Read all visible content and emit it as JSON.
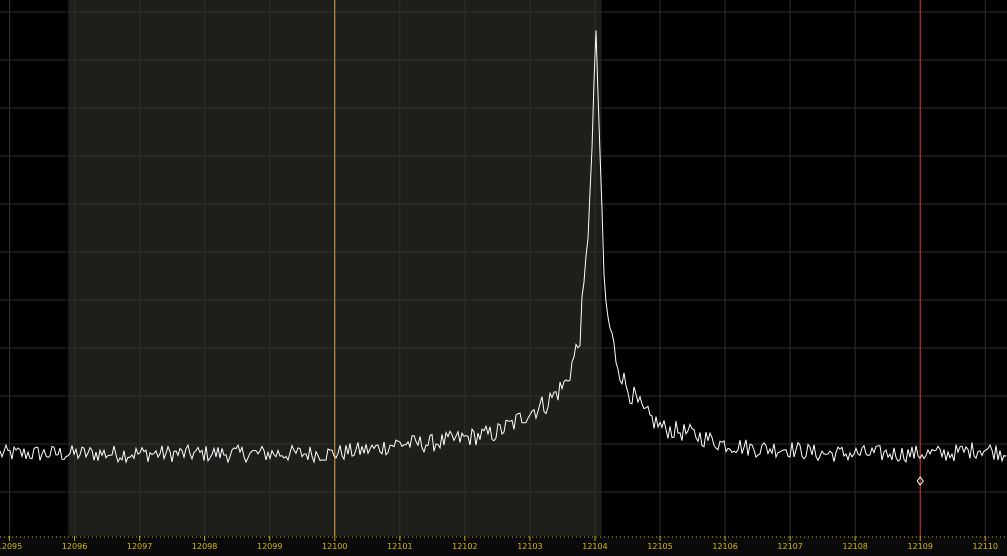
{
  "display": {
    "background": "#000000",
    "passband_fill": "#1e1f1a",
    "grid_color": "#2e302c",
    "trace_color": "#ffffff",
    "center_marker_color": "#e0a040",
    "cursor_marker_color": "#d83030",
    "axis_color": "#c8a800",
    "axis_bar_color": "#0a0a0a"
  },
  "chart_data": {
    "type": "line",
    "title": "",
    "xlabel": "",
    "ylabel": "",
    "xlim": [
      12094.9,
      12110.38
    ],
    "ylim": [
      0,
      1
    ],
    "grid": true,
    "x_ticks": [
      12095,
      12096,
      12097,
      12098,
      12099,
      12100,
      12101,
      12102,
      12103,
      12104,
      12105,
      12106,
      12107,
      12108,
      12109,
      12110
    ],
    "tick_labels": [
      "12095",
      "12096",
      "12097",
      "12098",
      "12099",
      "12100",
      "12101",
      "12102",
      "12103",
      "12104",
      "12105",
      "12106",
      "12107",
      "12108",
      "12109",
      "12110"
    ],
    "passband": [
      12095.95,
      12104.15
    ],
    "center_marker": 12100,
    "cursor_marker": 12109,
    "peak": {
      "x": 12104.06,
      "y": 0.95
    },
    "noise_floor": 0.1,
    "series": [
      {
        "x": [
          12095.0,
          12096.0,
          12097.0,
          12098.0,
          12099.0,
          12100.0,
          12100.7,
          12101.0,
          12101.5,
          12102.0,
          12102.5,
          12102.8,
          12103.0,
          12103.3,
          12103.6,
          12103.8,
          12103.9,
          12104.0,
          12104.06,
          12104.12,
          12104.2,
          12104.35,
          12104.5,
          12104.8,
          12105.1,
          12105.5,
          12106.0,
          12106.5,
          12107.0,
          12107.5,
          12108.0,
          12108.5,
          12109.0,
          12109.5,
          12110.0,
          12110.38
        ],
        "y": [
          0.1,
          0.1,
          0.1,
          0.1,
          0.1,
          0.1,
          0.11,
          0.12,
          0.12,
          0.13,
          0.14,
          0.16,
          0.18,
          0.2,
          0.24,
          0.32,
          0.45,
          0.7,
          0.95,
          0.7,
          0.4,
          0.3,
          0.24,
          0.18,
          0.15,
          0.14,
          0.12,
          0.11,
          0.11,
          0.1,
          0.1,
          0.1,
          0.1,
          0.1,
          0.11,
          0.1
        ]
      }
    ]
  }
}
